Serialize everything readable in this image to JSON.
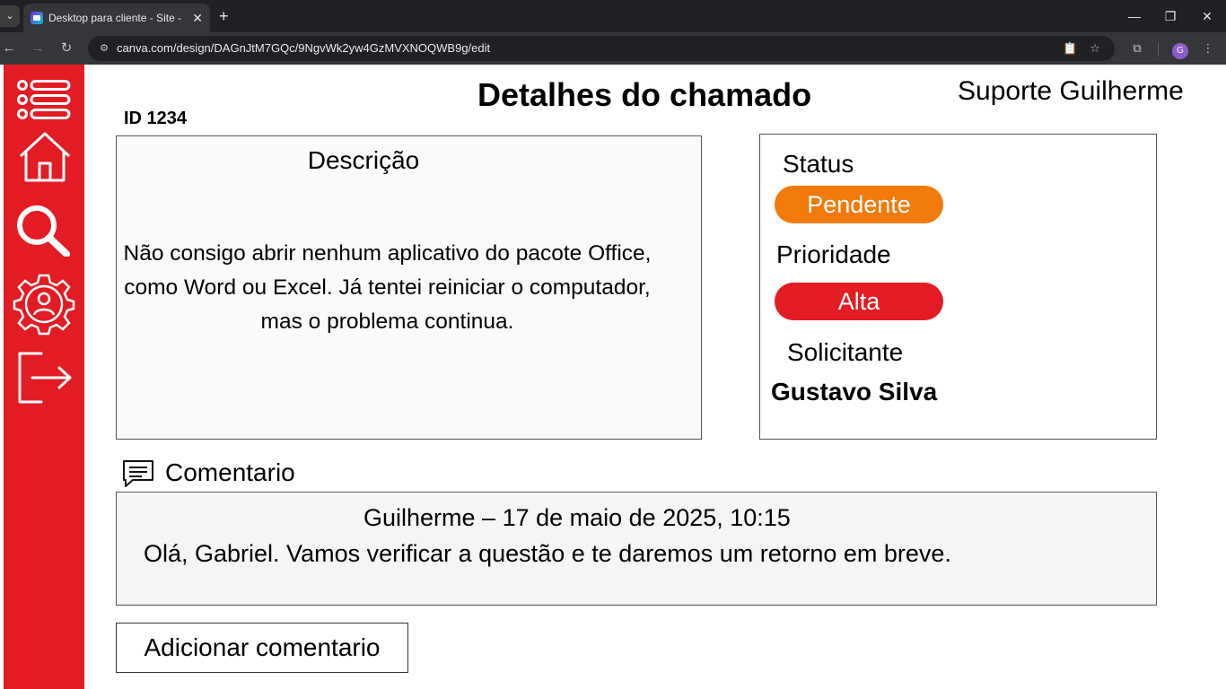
{
  "browser": {
    "tab_title": "Desktop para cliente - Site - Canva",
    "tab_close": "✕",
    "new_tab": "+",
    "url": "canva.com/design/DAGnJtM7GQc/9NgvWk2yw4GzMVXNOQWB9g/edit",
    "profile_initial": "G",
    "window_minimize": "—",
    "window_restore": "❐",
    "window_close": "✕"
  },
  "sidebar": {
    "items": [
      {
        "icon": "menu-list-icon"
      },
      {
        "icon": "home-icon"
      },
      {
        "icon": "search-icon"
      },
      {
        "icon": "user-settings-gear-icon"
      },
      {
        "icon": "logout-icon"
      }
    ]
  },
  "header": {
    "title": "Detalhes do chamado",
    "user": "Suporte Guilherme",
    "ticket_id": "ID 1234"
  },
  "description": {
    "heading": "Descrição",
    "text": "Não consigo abrir nenhum aplicativo do pacote Office, como Word ou Excel. Já tentei reiniciar o computador, mas o problema continua."
  },
  "details": {
    "status_label": "Status",
    "status_value": "Pendente",
    "priority_label": "Prioridade",
    "priority_value": "Alta",
    "requester_label": "Solicitante",
    "requester_value": "Gustavo Silva"
  },
  "comments": {
    "heading": "Comentario",
    "items": [
      {
        "meta": "Guilherme – 17 de maio de 2025, 10:15",
        "text": "Olá, Gabriel. Vamos verificar a questão e te daremos um retorno em breve."
      }
    ],
    "add_button": "Adicionar comentario"
  },
  "colors": {
    "sidebar": "#e31b23",
    "status_pending": "#f27a0a",
    "priority_high": "#e31b23"
  }
}
